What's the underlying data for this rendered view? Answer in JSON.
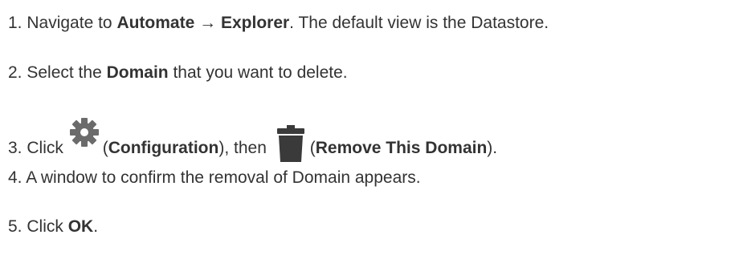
{
  "steps": [
    {
      "number": "1.",
      "pre": "Navigate to",
      "bold1": "Automate",
      "arrow": "→",
      "bold2": "Explorer",
      "post": ". The default view is the Datastore."
    },
    {
      "number": "2.",
      "pre": "Select the",
      "bold": "Domain",
      "post": "that you want to delete."
    },
    {
      "number": "3.",
      "pre": "Click",
      "icon1": "gear-icon",
      "open1": "(",
      "bold1": "Configuration",
      "close1": "), then",
      "icon2": "trash-icon",
      "open2": "(",
      "bold2": "Remove This Domain",
      "close2": ")."
    },
    {
      "number": "4.",
      "text": "A window to confirm the removal of Domain appears."
    },
    {
      "number": "5.",
      "pre": "Click",
      "bold": "OK",
      "post": "."
    }
  ],
  "colors": {
    "text": "#333333",
    "icon_gray": "#6b6b6b",
    "icon_dark": "#3a3a3a"
  }
}
